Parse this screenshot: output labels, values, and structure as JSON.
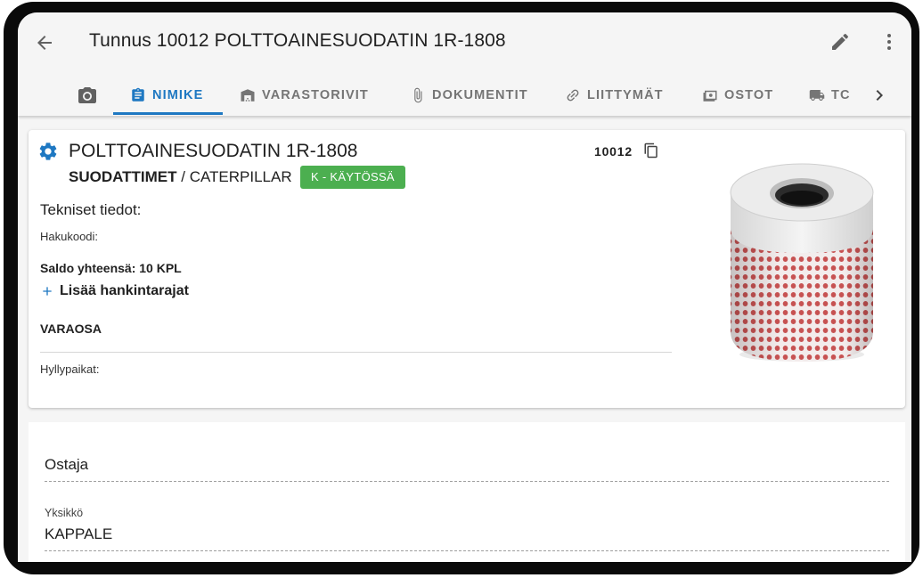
{
  "header": {
    "title": "Tunnus 10012 POLTTOAINESUODATIN 1R-1808"
  },
  "tabs": [
    {
      "label": "",
      "icon": "camera-icon"
    },
    {
      "label": "NIMIKE",
      "icon": "clipboard-icon",
      "active": true
    },
    {
      "label": "VARASTORIVIT",
      "icon": "warehouse-icon"
    },
    {
      "label": "DOKUMENTIT",
      "icon": "paperclip-icon"
    },
    {
      "label": "LIITTYMÄT",
      "icon": "link-icon"
    },
    {
      "label": "OSTOT",
      "icon": "money-icon"
    },
    {
      "label": "TC",
      "icon": "truck-icon"
    }
  ],
  "item": {
    "name": "POLTTOAINESUODATIN 1R-1808",
    "code": "10012",
    "category": "SUODATTIMET",
    "separator": " / ",
    "manufacturer": "CATERPILLAR",
    "status": "K - KÄYTÖSSÄ",
    "tech_heading": "Tekniset tiedot:",
    "search_code_label": "Hakukoodi:",
    "balance": "Saldo yhteensä: 10 KPL",
    "add_limits": "Lisää hankintarajat",
    "type": "VARAOSA",
    "shelf_label": "Hyllypaikat:"
  },
  "form": {
    "buyer_value": "Ostaja",
    "unit_label": "Yksikkö",
    "unit_value": "KAPPALE"
  },
  "colors": {
    "accent": "#1e78c2",
    "status_green": "#4caf50",
    "background": "#f5f5f5"
  }
}
